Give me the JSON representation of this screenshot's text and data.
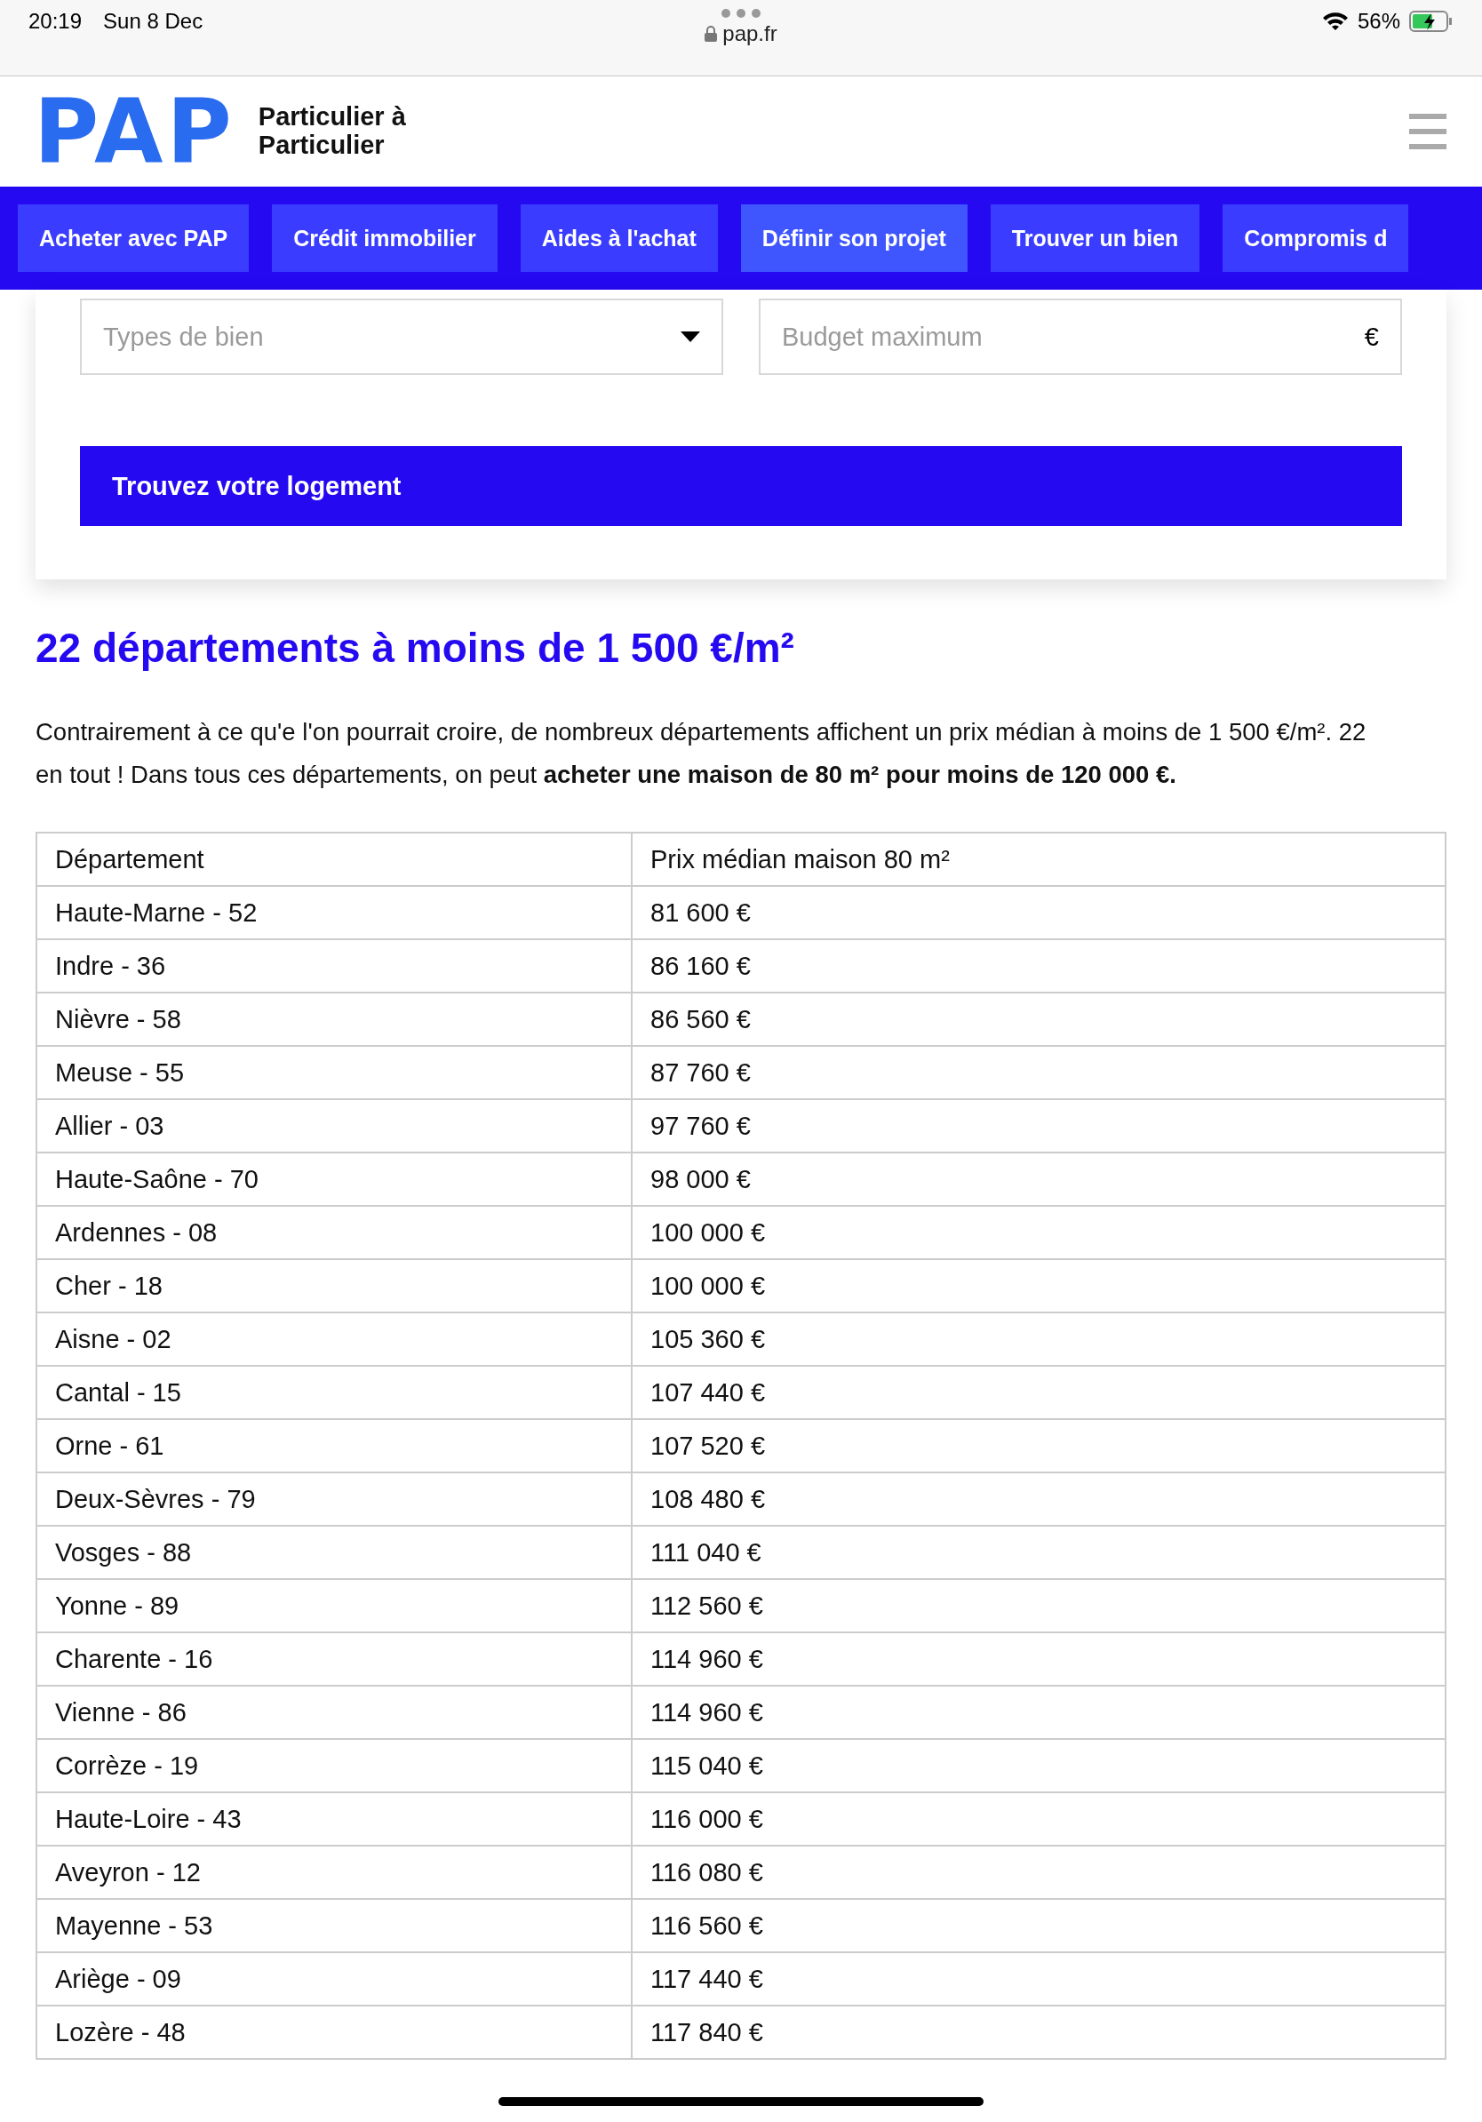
{
  "status_bar": {
    "time": "20:19",
    "date": "Sun 8 Dec",
    "url": "pap.fr",
    "battery": "56%"
  },
  "header": {
    "logo": "PAP",
    "tagline": "Particulier à Particulier"
  },
  "nav": [
    {
      "label": "Acheter avec PAP",
      "selected": false
    },
    {
      "label": "Crédit immobilier",
      "selected": false
    },
    {
      "label": "Aides à l'achat",
      "selected": false
    },
    {
      "label": "Définir son projet",
      "selected": true
    },
    {
      "label": "Trouver un bien",
      "selected": false
    },
    {
      "label": "Compromis d",
      "selected": false
    }
  ],
  "search_form": {
    "property_type": {
      "placeholder": "Types de bien"
    },
    "budget": {
      "placeholder": "Budget maximum",
      "unit": "€"
    },
    "submit": "Trouvez votre logement"
  },
  "article": {
    "heading": "22 départements à moins de 1 500 €/m²",
    "paragraph": "Contrairement à ce qu'e l'on pourrait croire, de nombreux départements affichent un prix médian à moins de 1 500 €/m². 22 en tout ! Dans tous ces départements, on peut **acheter une maison de 80 m² pour moins de 120 000 €.**"
  },
  "table": {
    "columns": [
      "Département",
      "Prix médian maison 80 m²"
    ],
    "rows": [
      [
        "Haute-Marne - 52",
        "81 600 €"
      ],
      [
        "Indre - 36",
        "86 160 €"
      ],
      [
        "Nièvre - 58",
        "86 560 €"
      ],
      [
        "Meuse - 55",
        "87 760 €"
      ],
      [
        "Allier - 03",
        "97 760 €"
      ],
      [
        "Haute-Saône - 70",
        "98 000 €"
      ],
      [
        "Ardennes - 08",
        "100 000 €"
      ],
      [
        "Cher - 18",
        "100 000 €"
      ],
      [
        "Aisne - 02",
        "105 360 €"
      ],
      [
        "Cantal - 15",
        "107 440 €"
      ],
      [
        "Orne - 61",
        "107 520 €"
      ],
      [
        "Deux-Sèvres - 79",
        "108 480 €"
      ],
      [
        "Vosges - 88",
        "111 040 €"
      ],
      [
        "Yonne - 89",
        "112 560 €"
      ],
      [
        "Charente - 16",
        "114 960 €"
      ],
      [
        "Vienne - 86",
        "114 960 €"
      ],
      [
        "Corrèze - 19",
        "115 040 €"
      ],
      [
        "Haute-Loire - 43",
        "116 000 €"
      ],
      [
        "Aveyron - 12",
        "116 080 €"
      ],
      [
        "Mayenne - 53",
        "116 560 €"
      ],
      [
        "Ariège - 09",
        "117 440 €"
      ],
      [
        "Lozère - 48",
        "117 840 €"
      ]
    ]
  }
}
